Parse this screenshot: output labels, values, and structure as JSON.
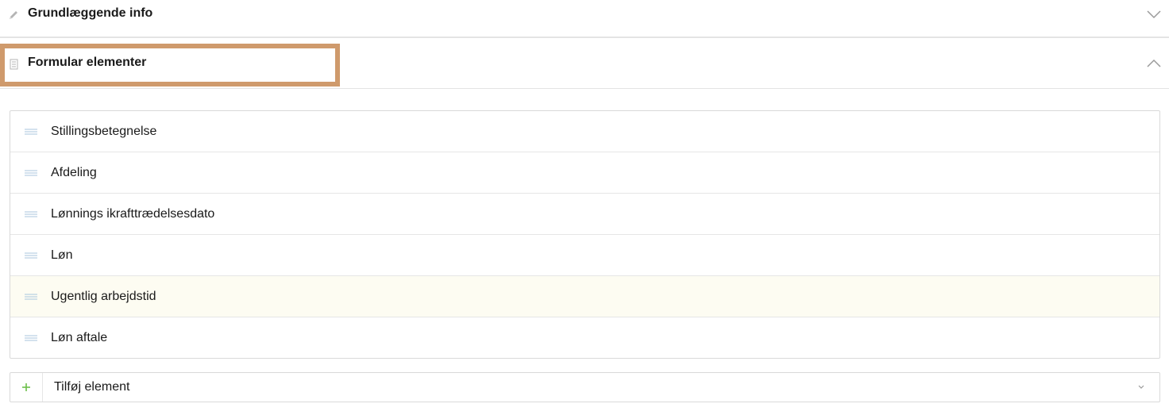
{
  "sections": {
    "basic_info": {
      "title": "Grundlæggende info",
      "icon": "pencil-icon",
      "state": "collapsed"
    },
    "form_elements": {
      "title": "Formular elementer",
      "icon": "document-icon",
      "state": "expanded",
      "items": [
        {
          "label": "Stillingsbetegnelse"
        },
        {
          "label": "Afdeling"
        },
        {
          "label": "Lønnings ikrafttrædelsesdato"
        },
        {
          "label": "Løn"
        },
        {
          "label": "Ugentlig arbejdstid"
        },
        {
          "label": "Løn aftale"
        }
      ],
      "add_element": {
        "label": "Tilføj element",
        "icon": "plus-icon"
      }
    }
  },
  "colors": {
    "highlight_outline": "#cf9a6c",
    "hover_row": "#fdfcf2",
    "add_icon": "#6cc04a",
    "drag_handle": "#a8c6dd"
  }
}
